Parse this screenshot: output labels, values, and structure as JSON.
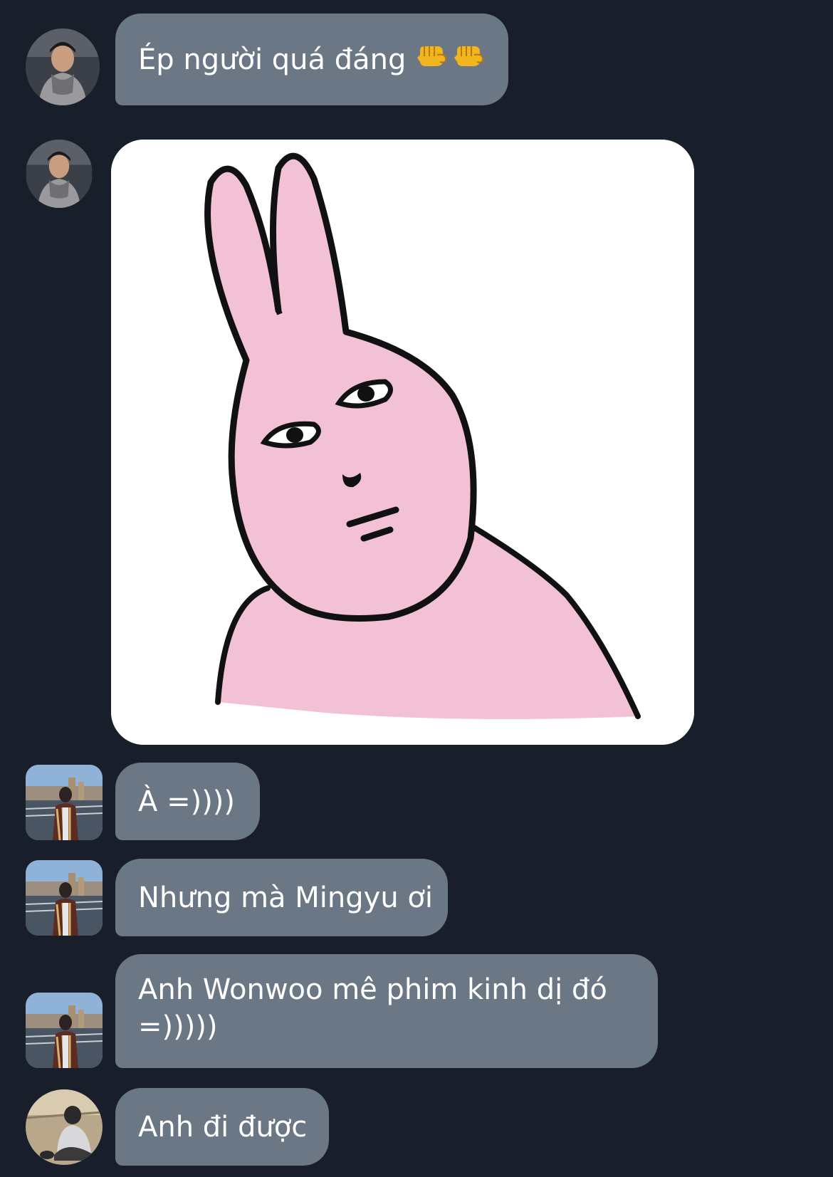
{
  "conversation": {
    "messages": [
      {
        "type": "text",
        "text": "Ép người quá đáng",
        "emoji": [
          "fist-bump-icon",
          "fist-bump-icon"
        ],
        "avatar": "avatar-mingyu-scarf"
      },
      {
        "type": "sticker",
        "sticker": "pink-rabbit-sticker",
        "avatar": "avatar-mingyu-scarf"
      },
      {
        "type": "text",
        "text": "À =))))",
        "avatar": "avatar-riverside"
      },
      {
        "type": "text",
        "text": "Nhưng mà Mingyu ơi",
        "avatar": "avatar-riverside"
      },
      {
        "type": "text",
        "text": "Anh Wonwoo mê phim kinh dị đó =)))))",
        "avatar": "avatar-riverside"
      },
      {
        "type": "text",
        "text": "Anh đi được",
        "avatar": "avatar-crouching"
      }
    ]
  },
  "colors": {
    "background": "#181f2a",
    "bubble": "#6b7785",
    "bubble_text": "#ffffff",
    "sticker_background": "#ffffff",
    "rabbit_pink": "#f2c1d6"
  }
}
